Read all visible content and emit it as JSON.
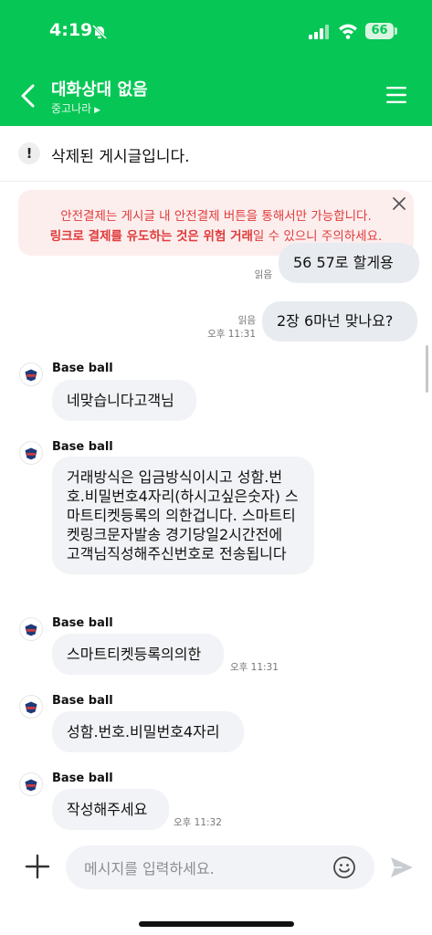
{
  "status_bar": {
    "time": "4:19",
    "battery": "66"
  },
  "header": {
    "title": "대화상대 없음",
    "subtitle": "중고나라"
  },
  "notice": {
    "deleted_text": "삭제된 게시글입니다."
  },
  "warning": {
    "line1": "안전결제는 게시글 내 안전결제 버튼을 통해서만 가능합니다.",
    "line2_bold_a": "링크로 결제를 유도하는 것은",
    "line2_bold_b": " 위험 거래",
    "line2_rest": "일 수 있으니 주의하세요."
  },
  "messages": {
    "out1": {
      "text": "56 57로 할게용",
      "read": "읽음"
    },
    "out2": {
      "text": "2장 6마넌 맞나요?",
      "read": "읽음",
      "time": "오후 11:31"
    },
    "in1": {
      "sender": "Base ball",
      "text": "네맞습니다고객님"
    },
    "in2": {
      "sender": "Base ball",
      "text": "거래방식은 입금방식이시고 성함.번호.비밀번호4자리(하시고싶은숫자) 스마트티켓등록의 의한겁니다. 스마트티켓링크문자발송 경기당일2시간전에 고객님직성해주신번호로 전송됩니다"
    },
    "in3": {
      "sender": "Base ball",
      "text": "스마트티켓등록의의한",
      "time": "오후 11:31"
    },
    "in4": {
      "sender": "Base ball",
      "text": "성함.번호.비밀번호4자리"
    },
    "in5": {
      "sender": "Base ball",
      "text": "작성해주세요",
      "time": "오후 11:32"
    }
  },
  "composer": {
    "placeholder": "메시지를 입력하세요."
  },
  "colors": {
    "brand_green": "#06c755",
    "warning_red": "#e03b3b",
    "warning_bg": "#fdeeee"
  },
  "icons": [
    "bell-off-icon",
    "signal-icon",
    "wifi-icon",
    "back-icon",
    "menu-icon",
    "exclamation-icon",
    "close-icon",
    "avatar-icon",
    "plus-icon",
    "emoji-icon",
    "send-icon"
  ]
}
